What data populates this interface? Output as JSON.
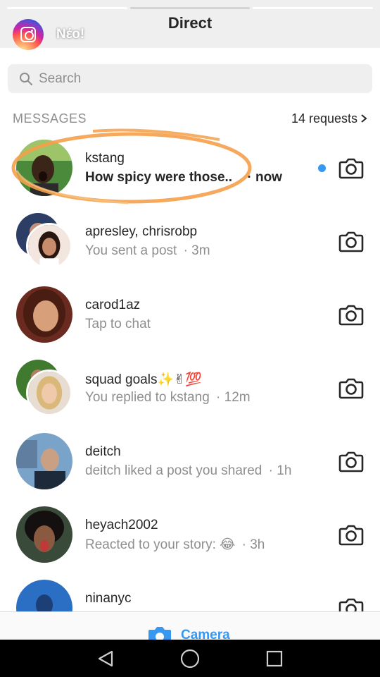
{
  "header": {
    "title": "Direct",
    "new_label": "Νέο!"
  },
  "search": {
    "placeholder": "Search"
  },
  "section": {
    "label": "MESSAGES",
    "requests": "14 requests"
  },
  "threads": [
    {
      "name": "kstang",
      "preview": "How spicy were those..",
      "time": "· now",
      "unread": true
    },
    {
      "name": "apresley, chrisrobp",
      "preview": "You sent a post",
      "time": "· 3m",
      "unread": false
    },
    {
      "name": "carod1az",
      "preview": "Tap to chat",
      "time": "",
      "unread": false
    },
    {
      "name": "squad goals✨✌💯",
      "preview": "You replied to kstang",
      "time": "· 12m",
      "unread": false
    },
    {
      "name": "deitch",
      "preview": "deitch liked a post you shared",
      "time": "· 1h",
      "unread": false
    },
    {
      "name": "heyach2002",
      "preview": "Reacted to your story: 😂",
      "time": "· 3h",
      "unread": false
    },
    {
      "name": "ninanyc",
      "preview": "",
      "time": "",
      "unread": false
    }
  ],
  "bottom": {
    "camera_label": "Camera"
  },
  "colors": {
    "accent": "#3897f0",
    "highlight": "#f5a04a",
    "text_secondary": "#8e8e8e"
  },
  "icons": {
    "search": "search-icon",
    "thread_camera": "camera-icon",
    "chevron": "chevron-right-icon",
    "nav_back": "back-triangle-icon",
    "nav_home": "home-circle-icon",
    "nav_recents": "recents-square-icon"
  }
}
